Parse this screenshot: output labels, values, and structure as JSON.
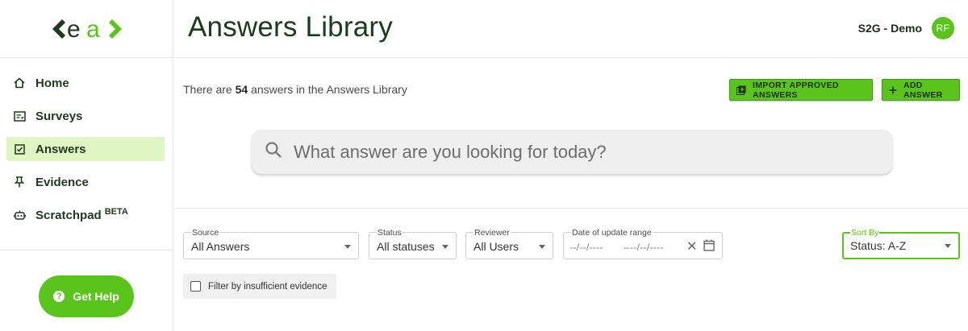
{
  "brand": {
    "logo_text": "ea",
    "accent": "#5bc41c",
    "dark": "#1c3a1c"
  },
  "sidebar": {
    "items": [
      {
        "label": "Home",
        "icon": "home-icon",
        "active": false
      },
      {
        "label": "Surveys",
        "icon": "survey-icon",
        "active": false
      },
      {
        "label": "Answers",
        "icon": "checkbox-icon",
        "active": true
      },
      {
        "label": "Evidence",
        "icon": "pin-icon",
        "active": false
      },
      {
        "label": "Scratchpad",
        "icon": "robot-icon",
        "active": false,
        "badge": "BETA"
      }
    ],
    "help_label": "Get Help"
  },
  "header": {
    "title": "Answers Library",
    "org": "S2G - Demo",
    "avatar": "RF"
  },
  "summary": {
    "prefix": "There are ",
    "count": "54",
    "suffix": " answers in the Answers Library"
  },
  "actions": {
    "import_label": "IMPORT APPROVED ANSWERS",
    "add_label": "ADD ANSWER"
  },
  "search": {
    "placeholder": "What answer are you looking for today?"
  },
  "filters": {
    "source": {
      "label": "Source",
      "value": "All Answers"
    },
    "status": {
      "label": "Status",
      "value": "All statuses"
    },
    "reviewer": {
      "label": "Reviewer",
      "value": "All Users"
    },
    "date": {
      "label": "Date of update range",
      "start": "--/--/----",
      "end": "--/--/----"
    },
    "sort": {
      "label": "Sort By",
      "value": "Status: A-Z"
    },
    "insufficient_label": "Filter by insufficient evidence"
  }
}
